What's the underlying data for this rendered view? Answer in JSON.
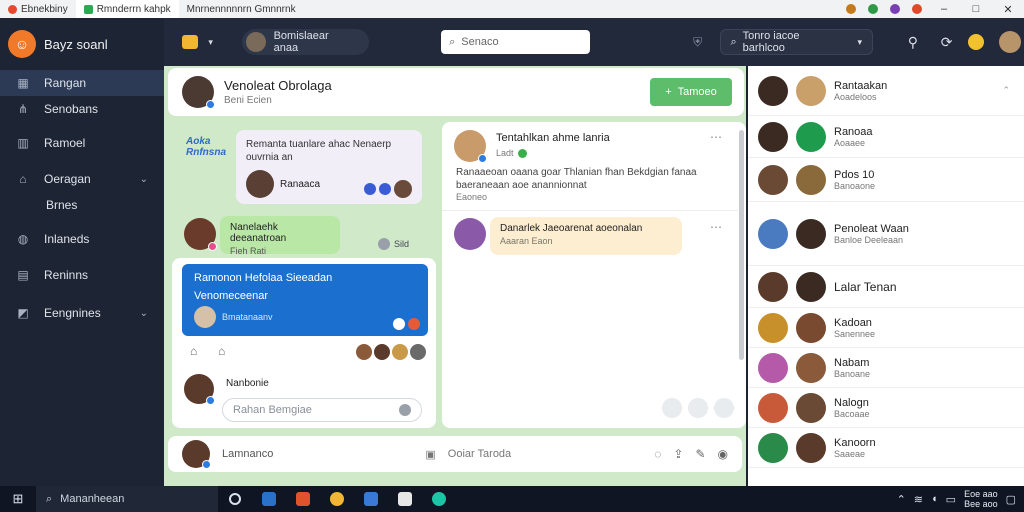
{
  "titlebar": {
    "tabs": [
      {
        "label": "Ebnekbiny",
        "color": "#e64a2e"
      },
      {
        "label": "Rmnderrn kahpk",
        "color": "#2fa84f"
      },
      {
        "label": "Mnrnennnnnrn Gmnnrnk",
        "color": "#9aa3b2"
      }
    ],
    "window_buttons": [
      "–",
      "□",
      "✕"
    ],
    "tray_colors": [
      "#c47a1a",
      "#2f9a46",
      "#7b3fb5",
      "#e04a2a"
    ]
  },
  "sidebar": {
    "brand": "Bayz soanl",
    "items": [
      {
        "label": "Rangan",
        "icon": "grid-icon",
        "glyph": "▦",
        "active": true
      },
      {
        "label": "Senobans",
        "icon": "network-icon",
        "glyph": "⋔"
      },
      {
        "label": "Ramoel",
        "icon": "building-icon",
        "glyph": "▥"
      },
      {
        "label": "Oeragan",
        "icon": "home-icon",
        "glyph": "⌂",
        "chevron": "⌄"
      },
      {
        "label": "Brnes",
        "sub": true
      },
      {
        "label": "Inlaneds",
        "icon": "globe-icon",
        "glyph": "◍"
      },
      {
        "label": "Reninns",
        "icon": "document-icon",
        "glyph": "▤"
      },
      {
        "label": "Eengnines",
        "icon": "layers-icon",
        "glyph": "◩",
        "chevron": "⌄"
      }
    ]
  },
  "topbar": {
    "user_pill": "Bomislaear anaa",
    "search_placeholder": "Senaco",
    "pill2": "Tonro iacoe barhlcoo"
  },
  "header": {
    "title": "Venoleat Obrolaga",
    "subtitle": "Beni Ecien",
    "button": "Tamoeo"
  },
  "feed": {
    "post1": {
      "text": "Remanta tuanlare ahac Nenaerp ouvrnia an",
      "name": "Ranaaca"
    },
    "post2": {
      "text": "Nanelaehk deeanatroan",
      "meta": "Fieh Rati"
    },
    "post2_reply": "Sild",
    "post3": {
      "line1": "Ramonon Hefolaa Sieeadan",
      "line2": "Venomeceenar",
      "meta": "Bmatanaanv"
    },
    "composer_name": "Nanbonie",
    "composer_placeholder": "Rahan Bemgiae",
    "sidebar_label": "Aoka Rnfnsna"
  },
  "thread": {
    "author": "Tentahlkan ahme lanria",
    "date": "Ladt",
    "body": "Ranaaeoan oaana goar Thlanian fhan Bekdgian fanaa baeraneaan aoe anannionnat",
    "meta": "Eaoneo",
    "reply_text": "Danarlek Jaeoarenat aoeonalan",
    "reply_meta": "Aaaran Eaon"
  },
  "footer_row": {
    "name": "Lamnanco",
    "action": "Ooiar Taroda"
  },
  "rightpanel": {
    "rows": [
      {
        "name": "Rantaakan",
        "meta": "Aoadeloos"
      },
      {
        "name": "Ranoaa",
        "meta": "Aoaaee"
      },
      {
        "name": "Pdos 10",
        "meta": "Banoaone"
      },
      {
        "name": "Penoleat",
        "meta": "Banloe Deeleaan",
        "extra": "Waan"
      },
      {
        "name": "Lalar Tenan",
        "meta": ""
      },
      {
        "name": "Kadoan",
        "meta": "Sanennee"
      },
      {
        "name": "Nabam",
        "meta": "Banoane"
      },
      {
        "name": "Nalogn",
        "meta": "Bacoaae"
      },
      {
        "name": "Kanoorn",
        "meta": "Saaeae"
      }
    ]
  },
  "taskbar": {
    "search": "Mananheean",
    "time": "Eoe aao",
    "date": "Bee aoo",
    "app_colors": [
      "#2a72c9",
      "#e0542b",
      "#f2b632",
      "#3a7ad6",
      "#e7e7e7",
      "#1fc3a6"
    ]
  }
}
